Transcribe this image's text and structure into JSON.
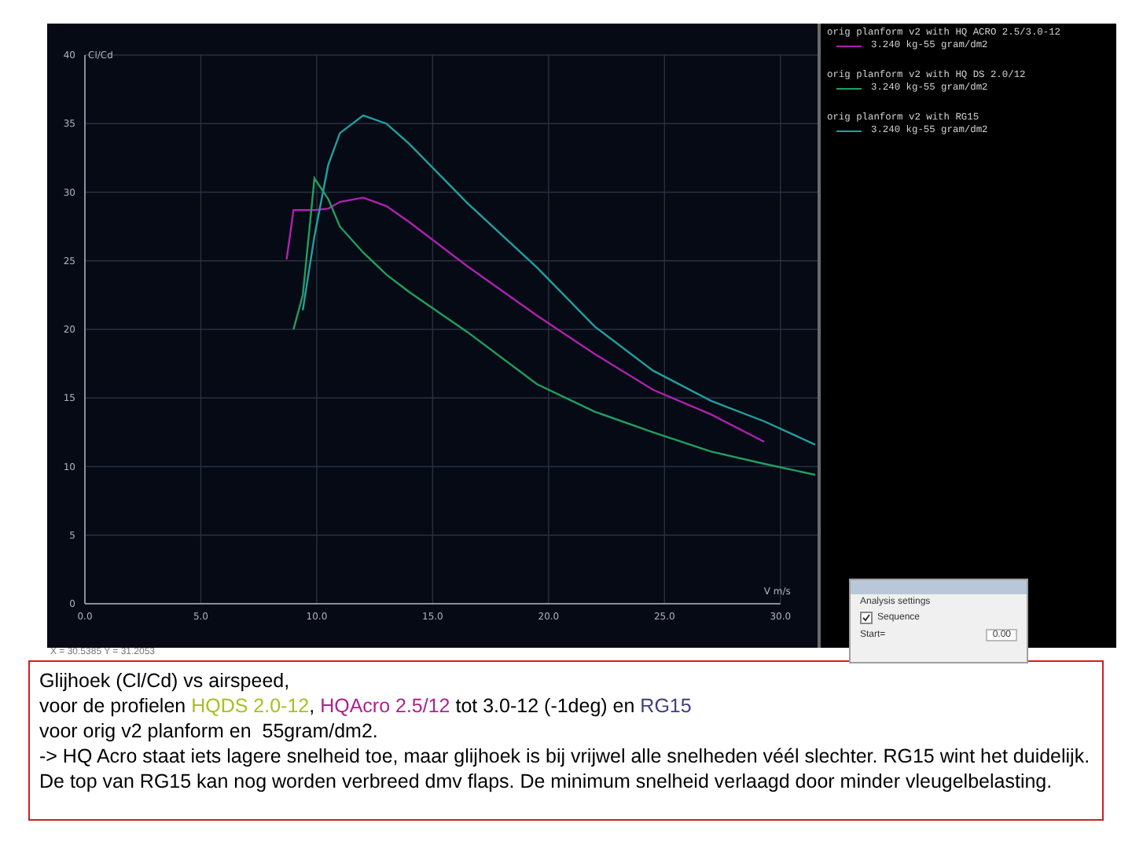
{
  "chart": {
    "chart_data": {
      "type": "line",
      "xlabel": "V m/s",
      "ylabel": "Cl/Cd",
      "x": [
        8.7,
        9.0,
        9.4,
        9.9,
        10.5,
        11.0,
        12.0,
        13.0,
        14.0,
        16.5,
        19.5,
        22.0,
        24.5,
        27.0,
        29.3,
        31.5
      ],
      "series": [
        {
          "name": "orig planform v2 with HQ ACRO 2.5/3.0-12",
          "color": "#b020b0",
          "values": [
            25.1,
            28.7,
            28.7,
            28.7,
            28.8,
            29.3,
            29.6,
            29.0,
            27.8,
            24.6,
            21.0,
            18.2,
            15.6,
            13.8,
            11.8,
            null
          ]
        },
        {
          "name": "orig planform v2 with HQ DS 2.0/12",
          "color": "#20a060",
          "values": [
            null,
            20.0,
            22.5,
            31.0,
            29.5,
            27.5,
            25.6,
            24.0,
            22.7,
            19.8,
            16.0,
            14.0,
            12.5,
            11.1,
            10.2,
            9.4
          ]
        },
        {
          "name": "orig planform v2 with RG15",
          "color": "#20a0a0",
          "values": [
            null,
            null,
            21.4,
            26.8,
            32.0,
            34.3,
            35.6,
            35.0,
            33.5,
            29.2,
            24.5,
            20.2,
            17.0,
            14.8,
            13.3,
            11.6
          ]
        }
      ],
      "xlim": [
        0,
        31.6
      ],
      "ylim": [
        0,
        40
      ],
      "grid": true,
      "xticks": [
        {
          "value": 0,
          "label": "0.0"
        },
        {
          "value": 5,
          "label": "5.0"
        },
        {
          "value": 10,
          "label": "10.0"
        },
        {
          "value": 15,
          "label": "15.0"
        },
        {
          "value": 20,
          "label": "20.0"
        },
        {
          "value": 25,
          "label": "25.0"
        },
        {
          "value": 30,
          "label": "30.0"
        }
      ],
      "yticks": [
        0,
        5,
        10,
        15,
        20,
        25,
        30,
        35,
        40
      ]
    }
  },
  "legend_details": [
    "3.240 kg-55 gram/dm2",
    "3.240 kg-55 gram/dm2",
    "3.240 kg-55 gram/dm2"
  ],
  "status_bar": "X = 30.5385 Y = 31.2053",
  "dialog": {
    "heading": "Analysis settings",
    "sequence": {
      "label": "Sequence",
      "checked": true
    },
    "start_label": "Start=",
    "start_value": "0.00"
  },
  "note": [
    [
      {
        "text": "Glijhoek (Cl/Cd) vs airspeed,"
      }
    ],
    [
      {
        "text": "voor de profielen "
      },
      {
        "text": "HQDS 2.0-12",
        "color": "#a8c020"
      },
      {
        "text": ", "
      },
      {
        "text": "HQAcro 2.5/12",
        "color": "#b02090"
      },
      {
        "text": " tot 3.0-12 (-1deg) en "
      },
      {
        "text": "RG15",
        "color": "#404080"
      }
    ],
    [
      {
        "text": "voor orig v2 planform en  55gram/dm2."
      }
    ],
    [
      {
        "text": "-> HQ Acro staat iets lagere snelheid toe, maar glijhoek is bij vrijwel alle snelheden véél slechter. RG15 wint het duidelijk. De top van RG15 kan nog worden verbreed dmv flaps. De minimum snelheid verlaagd door minder vleugelbelasting."
      }
    ]
  ]
}
